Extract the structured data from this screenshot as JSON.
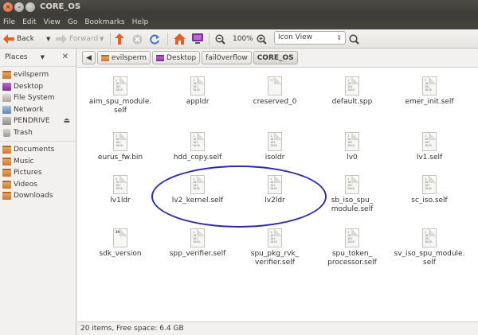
{
  "window": {
    "title": "CORE_OS"
  },
  "menu": [
    "File",
    "Edit",
    "View",
    "Go",
    "Bookmarks",
    "Help"
  ],
  "toolbar": {
    "back_label": "Back",
    "forward_label": "Forward",
    "zoom_level": "100%",
    "view_mode": "Icon View"
  },
  "places": {
    "title": "Places",
    "items": [
      {
        "label": "evilsperm",
        "icon": "home-folder-icon"
      },
      {
        "label": "Desktop",
        "icon": "desktop-icon"
      },
      {
        "label": "File System",
        "icon": "filesystem-icon"
      },
      {
        "label": "Network",
        "icon": "network-icon"
      },
      {
        "label": "PENDRIVE",
        "icon": "drive-icon"
      },
      {
        "label": "Trash",
        "icon": "trash-icon"
      },
      {
        "label": "Documents",
        "icon": "folder-icon"
      },
      {
        "label": "Music",
        "icon": "folder-icon"
      },
      {
        "label": "Pictures",
        "icon": "folder-icon"
      },
      {
        "label": "Videos",
        "icon": "folder-icon"
      },
      {
        "label": "Downloads",
        "icon": "folder-icon"
      }
    ]
  },
  "pathbar": [
    "evilsperm",
    "Desktop",
    "fail0verflow",
    "CORE_OS"
  ],
  "files": [
    {
      "name": "aim_spu_module.\nself",
      "kind": "binary"
    },
    {
      "name": "appldr",
      "kind": "binary"
    },
    {
      "name": "creserved_0",
      "kind": "unknown"
    },
    {
      "name": "default.spp",
      "kind": "binary"
    },
    {
      "name": "emer_init.self",
      "kind": "binary"
    },
    {
      "name": "eurus_fw.bin",
      "kind": "binary"
    },
    {
      "name": "hdd_copy.self",
      "kind": "binary"
    },
    {
      "name": "isoldr",
      "kind": "binary"
    },
    {
      "name": "lv0",
      "kind": "binary"
    },
    {
      "name": "lv1.self",
      "kind": "binary"
    },
    {
      "name": "lv1ldr",
      "kind": "binary"
    },
    {
      "name": "lv2_kernel.self",
      "kind": "binary"
    },
    {
      "name": "lv2ldr",
      "kind": "binary"
    },
    {
      "name": "sb_iso_spu_\nmodule.self",
      "kind": "binary"
    },
    {
      "name": "sc_iso.self",
      "kind": "binary"
    },
    {
      "name": "sdk_version",
      "kind": "text"
    },
    {
      "name": "spp_verifier.self",
      "kind": "binary"
    },
    {
      "name": "spu_pkg_rvk_\nverifier.self",
      "kind": "binary"
    },
    {
      "name": "spu_token_\nprocessor.self",
      "kind": "binary"
    },
    {
      "name": "sv_iso_spu_module.\nself",
      "kind": "binary"
    }
  ],
  "icon_text": {
    "binary": [
      "1",
      "10",
      "101",
      "1010"
    ],
    "unknown": [
      "?????"
    ],
    "text": [
      "341.0"
    ]
  },
  "status": {
    "text": "20 items, Free space: 6.4 GB"
  },
  "colors": {
    "annotation_oval": "#2c2ca6",
    "toolbar_orange": "#e0602a"
  }
}
